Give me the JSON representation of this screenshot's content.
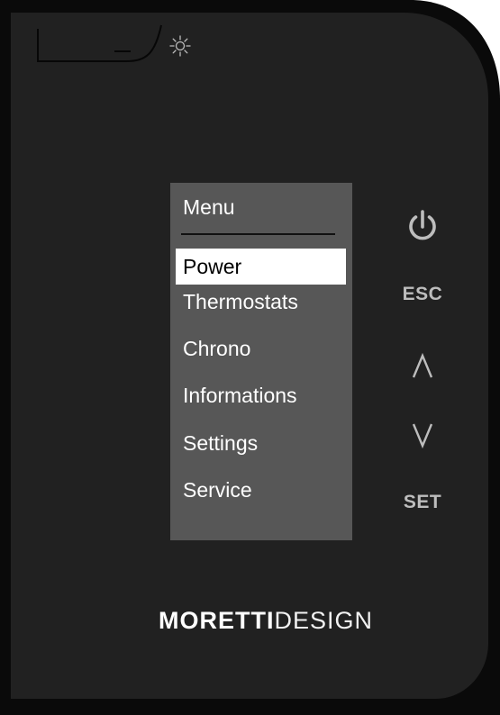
{
  "device": {
    "body_color": "#212121",
    "screen_color": "#575757",
    "icon_color": "#bdbdbd"
  },
  "sensor": {
    "icon": "sun-icon"
  },
  "menu": {
    "title": "Menu",
    "selected_index": 0,
    "items": [
      {
        "label": "Power"
      },
      {
        "label": "Thermostats"
      },
      {
        "label": "Chrono"
      },
      {
        "label": "Informations"
      },
      {
        "label": "Settings"
      },
      {
        "label": "Service"
      }
    ]
  },
  "controls": {
    "power_icon": "power-icon",
    "esc_label": "ESC",
    "up_icon": "chevron-up-icon",
    "down_icon": "chevron-down-icon",
    "set_label": "SET"
  },
  "brand": {
    "bold": "MORETTI",
    "light": "DESIGN"
  }
}
